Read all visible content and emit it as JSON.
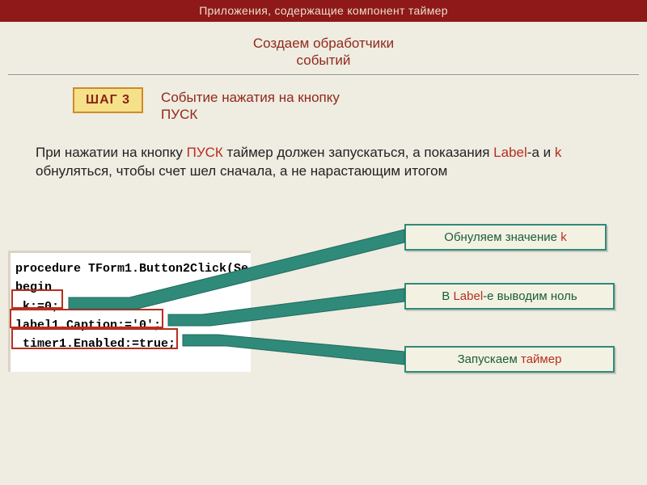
{
  "banner": "Приложения, содержащие компонент таймер",
  "subtitle_line1": "Создаем обработчики",
  "subtitle_line2": "событий",
  "step": {
    "badge": "ШАГ 3",
    "text_line1": "Событие нажатия на кнопку",
    "text_line2": "ПУСК"
  },
  "desc": {
    "t1": "При нажатии на кнопку ",
    "kw1": "ПУСК",
    "t2": " таймер должен запускаться, а показания ",
    "kw2": "Label",
    "t3": "-а и ",
    "kw3": "k",
    "t4": " обнуляться, чтобы счет шел сначала, а не нарастающим итогом"
  },
  "code": {
    "line1": "procedure TForm1.Button2Click(Se",
    "line2": "begin",
    "line3": " k:=0;",
    "line4": "label1.Caption:='0';",
    "line5": " timer1.Enabled:=true;"
  },
  "callouts": {
    "c1_a": "Обнуляем значение ",
    "c1_b": "k",
    "c2_a": "В ",
    "c2_b": "Label",
    "c2_c": "-е выводим ноль",
    "c3_a": "Запускаем ",
    "c3_b": "таймер"
  }
}
